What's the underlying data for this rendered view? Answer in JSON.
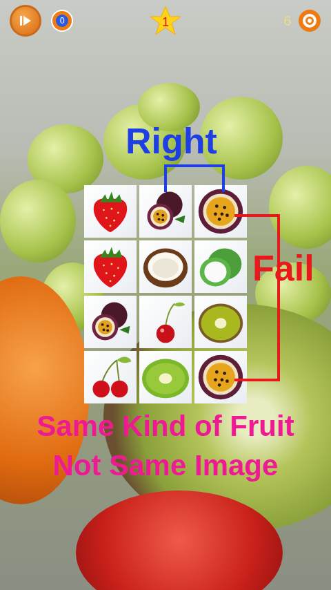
{
  "top_bar": {
    "hint_count": "0",
    "level": "1",
    "lives": "6"
  },
  "board": {
    "tiles": [
      {
        "kind": "strawberry"
      },
      {
        "kind": "passion-pair"
      },
      {
        "kind": "passion"
      },
      {
        "kind": "strawberry"
      },
      {
        "kind": "coconut"
      },
      {
        "kind": "green-coconut"
      },
      {
        "kind": "passion-pair"
      },
      {
        "kind": "cherry"
      },
      {
        "kind": "kiwi-half"
      },
      {
        "kind": "cherries"
      },
      {
        "kind": "kiwi-slice"
      },
      {
        "kind": "passion"
      }
    ]
  },
  "annotations": {
    "right": {
      "text": "Right",
      "color": "#1e3fe4"
    },
    "fail": {
      "text": "Fail",
      "color": "#e8181c"
    }
  },
  "caption": [
    "Same Kind of Fruit",
    "Not Same Image"
  ]
}
